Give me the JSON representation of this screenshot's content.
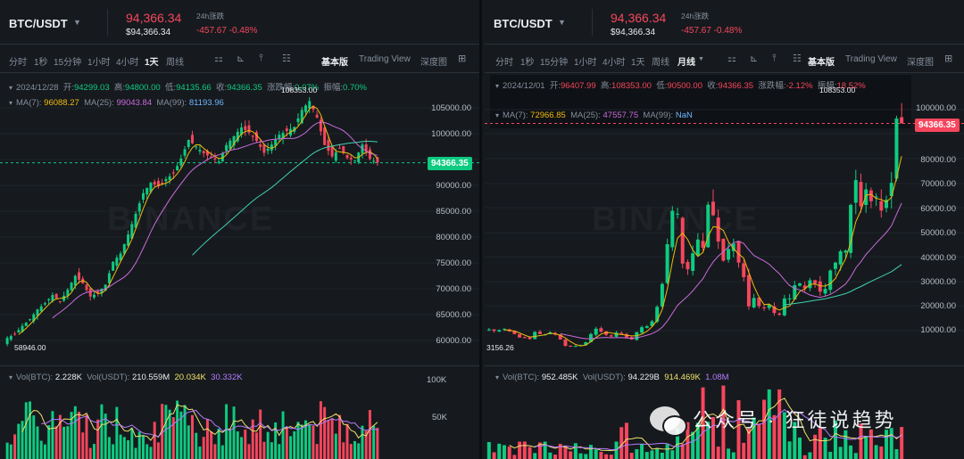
{
  "colors": {
    "up": "#0ecb81",
    "down": "#f6465d",
    "ma7": "#f0b90b",
    "ma25": "#c86bdb",
    "ma99": "#3fd1b0",
    "volma1": "#f0e26b",
    "volma2": "#b57bff"
  },
  "panels": [
    {
      "symbol": "BTC/USDT",
      "price": "94,366.34",
      "price_sub": "$94,366.34",
      "change_label": "24h涨跌",
      "change_value": "-457.67 -0.48%",
      "timeframes": [
        "分时",
        "1秒",
        "15分钟",
        "1小时",
        "4小时",
        "1天",
        "周线"
      ],
      "active_tf": "1天",
      "views": [
        "基本版",
        "Trading View",
        "深度图"
      ],
      "ohlc": {
        "date": "2024/12/28",
        "open_l": "开:",
        "open": "94299.03",
        "high_l": "高:",
        "high": "94800.00",
        "low_l": "低:",
        "low": "94135.66",
        "close_l": "收:",
        "close": "94366.35",
        "chg_l": "涨跌幅:",
        "chg": "0.07%",
        "amp_l": "振幅:",
        "amp": "0.70%"
      },
      "ma": {
        "ma7_l": "MA(7):",
        "ma7": "96088.27",
        "ma25_l": "MA(25):",
        "ma25": "99043.84",
        "ma99_l": "MA(99):",
        "ma99": "81193.96"
      },
      "vol": {
        "vol_btc_l": "Vol(BTC):",
        "vol_btc": "2.228K",
        "vol_usdt_l": "Vol(USDT):",
        "vol_usdt": "210.559M",
        "v1": "20.034K",
        "v2": "30.332K"
      },
      "price_axis": [
        "105000.00",
        "100000.00",
        "95000.00",
        "90000.00",
        "85000.00",
        "80000.00",
        "75000.00",
        "70000.00",
        "65000.00",
        "60000.00"
      ],
      "vol_axis": [
        "100K",
        "50K"
      ],
      "current_tag": "94366.35",
      "high_label": "108353.00",
      "low_label": "58946.00",
      "watermark": "BINANCE"
    },
    {
      "symbol": "BTC/USDT",
      "price": "94,366.34",
      "price_sub": "$94,366.34",
      "change_label": "24h涨跌",
      "change_value": "-457.67 -0.48%",
      "timeframes": [
        "分时",
        "1秒",
        "15分钟",
        "1小时",
        "4小时",
        "1天",
        "周线",
        "月线"
      ],
      "active_tf": "月线",
      "views": [
        "基本版",
        "Trading View",
        "深度图"
      ],
      "ohlc": {
        "date": "2024/12/01",
        "open_l": "开:",
        "open": "96407.99",
        "high_l": "高:",
        "high": "108353.00",
        "low_l": "低:",
        "low": "90500.00",
        "close_l": "收:",
        "close": "94366.35",
        "chg_l": "涨跌幅:",
        "chg": "-2.12%",
        "amp_l": "振幅:",
        "amp": "18.52%"
      },
      "ma": {
        "ma7_l": "MA(7):",
        "ma7": "72966.85",
        "ma25_l": "MA(25):",
        "ma25": "47557.75",
        "ma99_l": "MA(99):",
        "ma99": "NaN"
      },
      "vol": {
        "vol_btc_l": "Vol(BTC):",
        "vol_btc": "952.485K",
        "vol_usdt_l": "Vol(USDT):",
        "vol_usdt": "94.229B",
        "v1": "914.469K",
        "v2": "1.08M"
      },
      "price_axis": [
        "100000.00",
        "90000.00",
        "80000.00",
        "70000.00",
        "60000.00",
        "50000.00",
        "40000.00",
        "30000.00",
        "20000.00",
        "10000.00"
      ],
      "current_tag": "94366.35",
      "high_label": "108353.00",
      "low_label": "3156.26",
      "watermark": "BINANCE"
    }
  ],
  "overlay": {
    "text": "公众号 · 狂徒说趋势"
  },
  "chart_data": [
    {
      "type": "candlestick",
      "title": "BTC/USDT 1天",
      "ylim": [
        58946,
        108353
      ],
      "series_close_approx": [
        60500,
        61200,
        62800,
        64100,
        66000,
        67200,
        68800,
        67500,
        69800,
        72500,
        71000,
        68500,
        69200,
        70800,
        75200,
        76800,
        80500,
        84500,
        88500,
        90500,
        89800,
        91200,
        92300,
        95200,
        98800,
        97500,
        96200,
        95400,
        94600,
        97800,
        99500,
        101200,
        100200,
        98600,
        96300,
        97900,
        99800,
        100500,
        101300,
        104600,
        106300,
        103100,
        97800,
        95600,
        97200,
        95300,
        94800,
        97900,
        95100,
        94366
      ]
    },
    {
      "type": "candlestick",
      "title": "BTC/USDT 月线",
      "ylim": [
        3156.26,
        108353
      ],
      "series_close_approx": [
        10500,
        9900,
        10200,
        10800,
        9700,
        8600,
        7200,
        7300,
        6600,
        9500,
        8600,
        8500,
        9300,
        8400,
        6400,
        3800,
        3500,
        3800,
        4100,
        5300,
        8600,
        10800,
        9600,
        8300,
        7600,
        9200,
        8600,
        7200,
        6400,
        9400,
        11400,
        11800,
        13800,
        19700,
        29000,
        45200,
        58800,
        57600,
        37300,
        35000,
        41500,
        47100,
        43800,
        61300,
        57000,
        46300,
        38500,
        43200,
        45500,
        37700,
        31800,
        19900,
        23300,
        20000,
        19400,
        20500,
        17200,
        16500,
        23100,
        23100,
        28500,
        29200,
        27200,
        30500,
        29200,
        25900,
        27000,
        34500,
        37700,
        42300,
        42600,
        61200,
        71300,
        60600,
        67500,
        62700,
        64600,
        58900,
        63300,
        70200,
        96400,
        94366
      ]
    }
  ]
}
